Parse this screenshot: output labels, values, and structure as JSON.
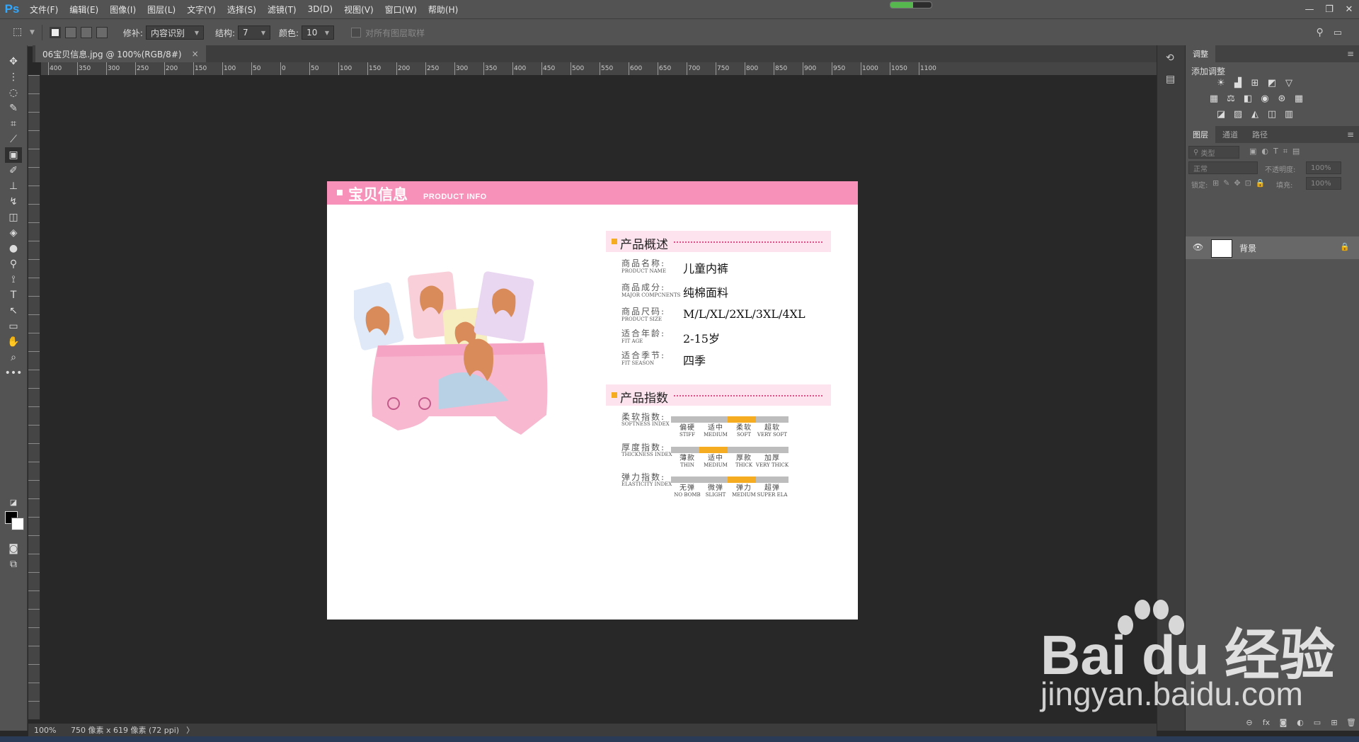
{
  "app": {
    "logo": "Ps"
  },
  "menu": [
    "文件(F)",
    "编辑(E)",
    "图像(I)",
    "图层(L)",
    "文字(Y)",
    "选择(S)",
    "滤镜(T)",
    "3D(D)",
    "视图(V)",
    "窗口(W)",
    "帮助(H)"
  ],
  "window_controls": [
    "—",
    "❐",
    "✕"
  ],
  "loading_progress": 0.55,
  "options": {
    "patch_label": "修补:",
    "patch_value": "内容识别",
    "structure_label": "结构:",
    "structure_value": "7",
    "color_label": "颜色:",
    "color_value": "10",
    "sample_all": "对所有图层取样"
  },
  "document_tab": {
    "title": "06宝贝信息.jpg @ 100%(RGB/8#)",
    "close": "×"
  },
  "ruler_top": [
    "400",
    "350",
    "300",
    "250",
    "200",
    "150",
    "100",
    "50",
    "0",
    "50",
    "100",
    "150",
    "200",
    "250",
    "300",
    "350",
    "400",
    "450",
    "500",
    "550",
    "600",
    "650",
    "700",
    "750",
    "800",
    "850",
    "900",
    "950",
    "1000",
    "1050",
    "1100"
  ],
  "status": {
    "zoom": "100%",
    "info": "750 像素 x 619 像素 (72 ppi)",
    "arrow": "〉"
  },
  "doc": {
    "header_cn": "宝贝信息",
    "header_en": "PRODUCT INFO",
    "section1": "产品概述",
    "section2": "产品指数",
    "info": [
      {
        "cn": "商品名称:",
        "en": "PRODUCT NAME",
        "value": "儿童内裤"
      },
      {
        "cn": "商品成分:",
        "en": "MAJOR COMPCNENTS",
        "value": "纯棉面料"
      },
      {
        "cn": "商品尺码:",
        "en": "PRODUCT SIZE",
        "value": "M/L/XL/2XL/3XL/4XL"
      },
      {
        "cn": "适合年龄:",
        "en": "FIT AGE",
        "value": "2-15岁"
      },
      {
        "cn": "适合季节:",
        "en": "FIT SEASON",
        "value": "四季"
      }
    ],
    "indexes": [
      {
        "cn": "柔软指数:",
        "en": "SOFTNESS INDEX",
        "active": 2,
        "levels": [
          {
            "cn": "偏硬",
            "en": "STIFF"
          },
          {
            "cn": "适中",
            "en": "MEDIUM"
          },
          {
            "cn": "柔软",
            "en": "SOFT"
          },
          {
            "cn": "超软",
            "en": "VERY SOFT"
          }
        ]
      },
      {
        "cn": "厚度指数:",
        "en": "THICKNESS INDEX",
        "active": 1,
        "levels": [
          {
            "cn": "薄款",
            "en": "THIN"
          },
          {
            "cn": "适中",
            "en": "MEDIUM"
          },
          {
            "cn": "厚款",
            "en": "THICK"
          },
          {
            "cn": "加厚",
            "en": "VERY THICK"
          }
        ]
      },
      {
        "cn": "弹力指数:",
        "en": "ELASTICITY INDEX",
        "active": 2,
        "levels": [
          {
            "cn": "无弹",
            "en": "NO BOMB"
          },
          {
            "cn": "微弹",
            "en": "SLIGHT"
          },
          {
            "cn": "弹力",
            "en": "MEDIUM"
          },
          {
            "cn": "超弹",
            "en": "SUPER ELA"
          }
        ]
      }
    ]
  },
  "panels": {
    "adjust_tab": "调整",
    "adjust_title": "添加调整",
    "layers_tabs": [
      "图层",
      "通道",
      "路径"
    ],
    "kind_label": "类型",
    "blend_mode": "正常",
    "opacity_label": "不透明度:",
    "opacity_value": "100%",
    "lock_label": "锁定:",
    "fill_label": "填充:",
    "fill_value": "100%",
    "layer_name": "背景"
  },
  "watermark": {
    "brand": "Bai du 经验",
    "url": "jingyan.baidu.com"
  },
  "colors": {
    "pink_header": "#f791b9",
    "index_active": "#f5ac21",
    "index_inactive": "#bdbdbd",
    "ps_blue": "#31a8ff"
  }
}
